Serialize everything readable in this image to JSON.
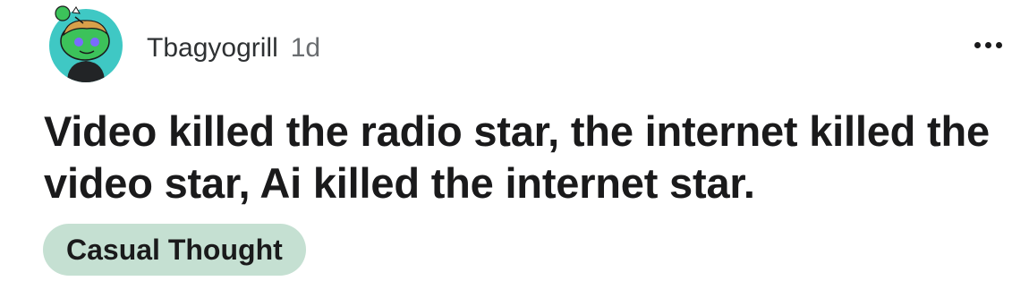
{
  "post": {
    "author": "Tbagyogrill",
    "age": "1d",
    "title": "Video killed the radio star, the internet killed the video star, Ai killed the internet star.",
    "flair": "Casual Thought"
  },
  "icons": {
    "avatar": "reddit-snoo-avatar-icon",
    "more": "more-options-icon"
  },
  "colors": {
    "flair_background": "#c5e0d2",
    "avatar_background": "#3fc8c4",
    "avatar_skin": "#3cc25a"
  }
}
